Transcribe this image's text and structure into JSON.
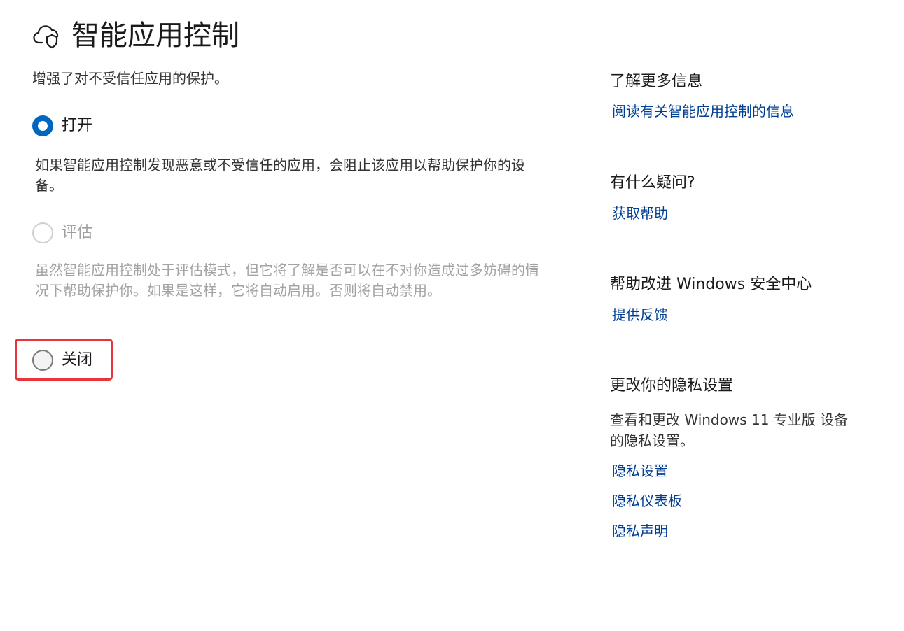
{
  "header": {
    "icon": "cloud-shield-icon",
    "title": "智能应用控制"
  },
  "subtitle": "增强了对不受信任应用的保护。",
  "options": {
    "on": {
      "label": "打开",
      "selected": true,
      "description": "如果智能应用控制发现恶意或不受信任的应用，会阻止该应用以帮助保护你的设备。"
    },
    "evaluate": {
      "label": "评估",
      "disabled": true,
      "description": "虽然智能应用控制处于评估模式，但它将了解是否可以在不对你造成过多妨碍的情况下帮助保护你。如果是这样，它将自动启用。否则将自动禁用。"
    },
    "off": {
      "label": "关闭",
      "selected": false
    }
  },
  "sidebar": {
    "learn_more": {
      "heading": "了解更多信息",
      "link": "阅读有关智能应用控制的信息"
    },
    "questions": {
      "heading": "有什么疑问?",
      "link": "获取帮助"
    },
    "improve": {
      "heading": "帮助改进 Windows 安全中心",
      "link": "提供反馈"
    },
    "privacy": {
      "heading": "更改你的隐私设置",
      "text": "查看和更改 Windows 11 专业版 设备的隐私设置。",
      "links": [
        "隐私设置",
        "隐私仪表板",
        "隐私声明"
      ]
    }
  },
  "colors": {
    "accent": "#0067c0",
    "link": "#003e92",
    "highlight": "#e8343a"
  }
}
